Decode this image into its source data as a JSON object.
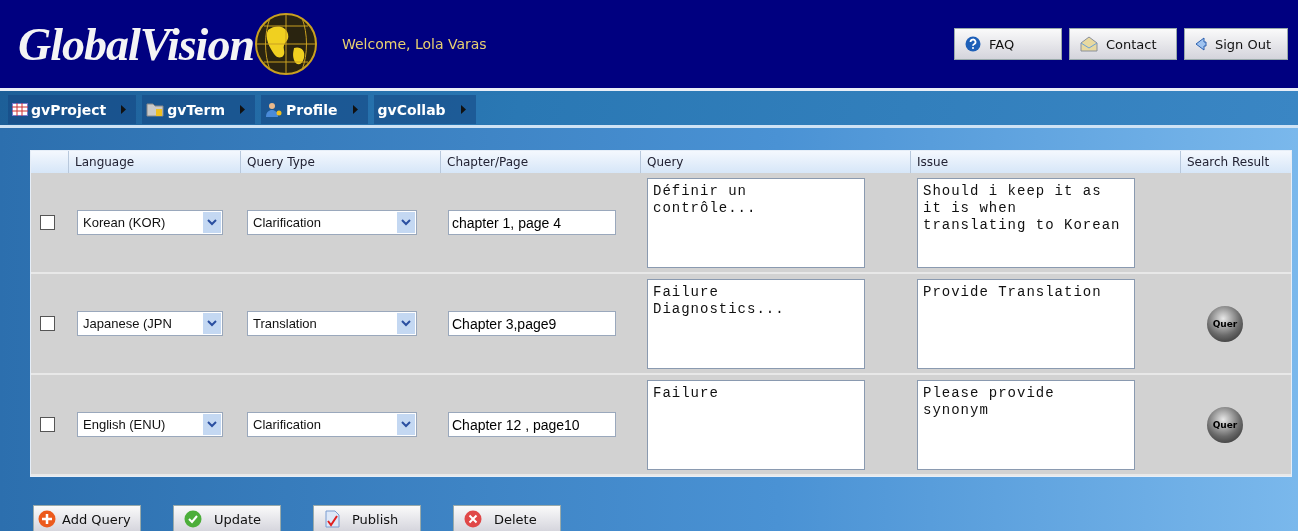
{
  "header": {
    "logo": "GlobalVision",
    "welcome": "Welcome, Lola Varas",
    "buttons": [
      {
        "kind": "help",
        "label": "FAQ"
      },
      {
        "kind": "mail",
        "label": "Contact"
      },
      {
        "kind": "back",
        "label": "Sign Out"
      }
    ]
  },
  "nav": [
    {
      "kind": "grid",
      "label": "gvProject"
    },
    {
      "kind": "folder",
      "label": "gvTerm"
    },
    {
      "kind": "person",
      "label": "Profile"
    },
    {
      "kind": "none",
      "label": "gvCollab"
    }
  ],
  "table": {
    "columns": [
      "Language",
      "Query Type",
      "Chapter/Page",
      "Query",
      "Issue",
      "Search Result"
    ],
    "rows": [
      {
        "checked": false,
        "language": "Korean (KOR)",
        "query_type": "Clarification",
        "chapter_page": "chapter 1, page 4",
        "query": "Définir un contrôle...",
        "issue": "Should i keep it as it is when translating to Korean"
      },
      {
        "checked": false,
        "language": "Japanese (JPN",
        "query_type": "Translation",
        "chapter_page": "Chapter 3,page9",
        "query": "Failure Diagnostics...",
        "issue": "Provide Translation",
        "search_result": "Quer"
      },
      {
        "checked": false,
        "language": "English (ENU)",
        "query_type": "Clarification",
        "chapter_page": "Chapter 12 , page10",
        "query": "Failure",
        "issue": "Please provide synonym",
        "search_result": "Quer"
      }
    ]
  },
  "actions": [
    {
      "kind": "add",
      "label": "Add Query"
    },
    {
      "kind": "ok",
      "label": "Update"
    },
    {
      "kind": "publish",
      "label": "Publish"
    },
    {
      "kind": "delete",
      "label": "Delete"
    }
  ]
}
